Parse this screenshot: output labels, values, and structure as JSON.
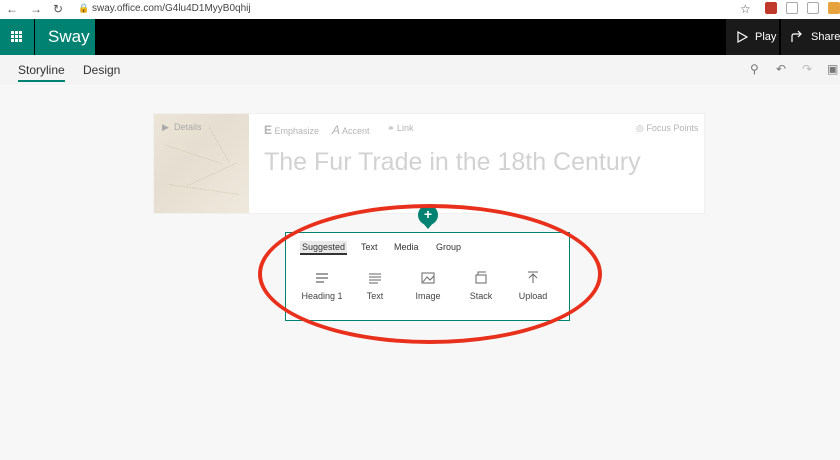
{
  "browser": {
    "url": "sway.office.com/G4lu4D1MyyB0qhij",
    "back_icon": "arrow-left-icon",
    "forward_icon": "arrow-right-icon",
    "reload_icon": "reload-icon"
  },
  "app": {
    "brand": "Sway",
    "play_label": "Play",
    "share_label": "Share"
  },
  "tabs": [
    {
      "label": "Storyline",
      "active": true
    },
    {
      "label": "Design",
      "active": false
    }
  ],
  "card": {
    "details_label": "Details",
    "emphasize_label": "Emphasize",
    "accent_label": "Accent",
    "link_label": "Link",
    "focus_points_label": "Focus Points",
    "title": "The Fur Trade in the 18th Century"
  },
  "insert_panel": {
    "plus_label": "+",
    "tabs": [
      "Suggested",
      "Text",
      "Media",
      "Group"
    ],
    "active_tab": "Suggested",
    "options": [
      {
        "label": "Heading 1",
        "icon": "heading-icon"
      },
      {
        "label": "Text",
        "icon": "text-icon"
      },
      {
        "label": "Image",
        "icon": "image-icon"
      },
      {
        "label": "Stack",
        "icon": "stack-icon"
      },
      {
        "label": "Upload",
        "icon": "upload-icon"
      }
    ]
  },
  "colors": {
    "accent": "#008272",
    "annotation": "#e8301c"
  }
}
